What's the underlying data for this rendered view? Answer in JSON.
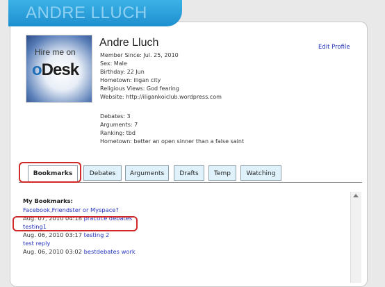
{
  "header": {
    "title": "ANDRE LLUCH"
  },
  "avatar": {
    "hire_text": "Hire me on",
    "logo_o": "o",
    "logo_rest": "Desk"
  },
  "profile": {
    "name": "Andre Lluch",
    "edit_label": "Edit Profile",
    "details": [
      "Member Since: Jul. 25, 2010",
      "Sex: Male",
      "Birthday: 22 Jun",
      "Hometown: iligan city",
      "Religious Views: God fearing",
      "Website: http://iligankoiclub.wordpress.com"
    ],
    "stats": [
      "Debates: 3",
      "Arguments: 7",
      "Ranking: tbd",
      "Hometown: better an open sinner than a false saint"
    ]
  },
  "tabs": [
    {
      "label": "Bookmarks",
      "active": true
    },
    {
      "label": "Debates",
      "active": false
    },
    {
      "label": "Arguments",
      "active": false
    },
    {
      "label": "Drafts",
      "active": false
    },
    {
      "label": "Temp",
      "active": false
    },
    {
      "label": "Watching",
      "active": false
    }
  ],
  "bookmarks": {
    "heading": "My Bookmarks:",
    "items": [
      {
        "date": "",
        "title": "Facebook,Friendster or Myspace?"
      },
      {
        "date": "Aug. 07, 2010 04:18",
        "title": "practice debates"
      },
      {
        "date": "",
        "title": "testing1"
      },
      {
        "date": "Aug. 06, 2010 03:17",
        "title": "testing 2"
      },
      {
        "date": "",
        "title": "test reply"
      },
      {
        "date": "Aug. 06, 2010 03:02",
        "title": "bestdebates work"
      }
    ]
  },
  "colors": {
    "header": "#1e8fcf",
    "link": "#2233bb",
    "highlight": "#d12727",
    "tab_bg": "#dff2fb"
  }
}
